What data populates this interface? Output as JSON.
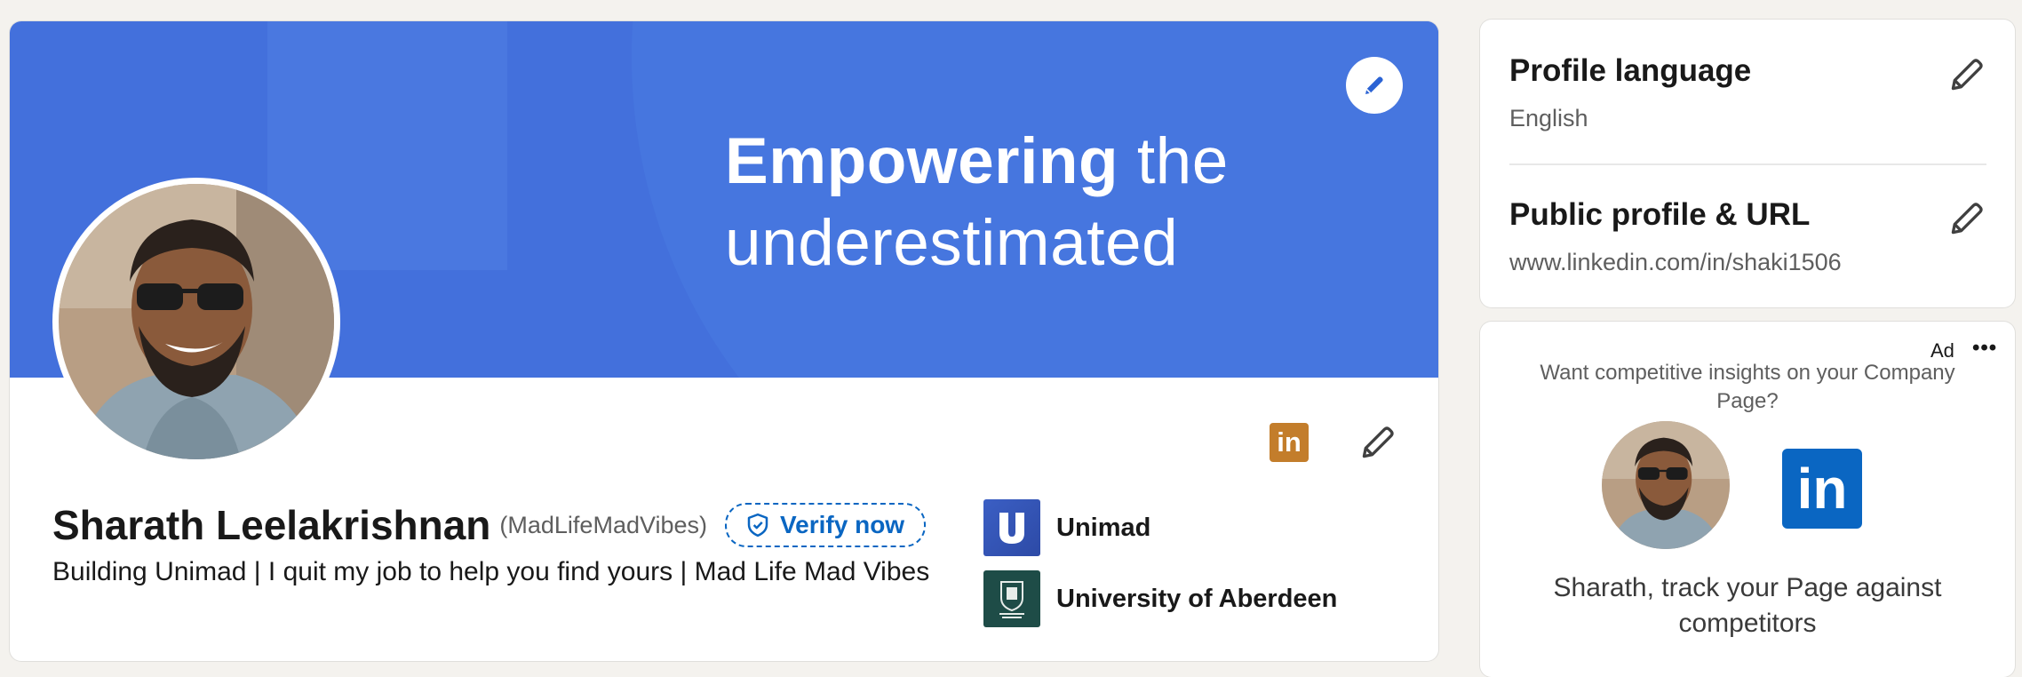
{
  "banner": {
    "title_bold": "Empowering",
    "title_rest": "the",
    "title_line2": "underestimated"
  },
  "profile": {
    "name": "Sharath Leelakrishnan",
    "pronoun": "(MadLifeMadVibes)",
    "verify_label": "Verify now",
    "headline": "Building Unimad | I quit my job to help you find yours | Mad Life Mad Vibes",
    "li_badge": "in"
  },
  "experience": [
    {
      "name": "Unimad",
      "logo_letter": "U",
      "logo_color": "#3b5fc4"
    },
    {
      "name": "University of Aberdeen",
      "logo_color": "#1e4c47"
    }
  ],
  "sidebar": {
    "language_title": "Profile language",
    "language_value": "English",
    "public_title": "Public profile & URL",
    "public_url": "www.linkedin.com/in/shaki1506"
  },
  "ad": {
    "label": "Ad",
    "more": "•••",
    "question": "Want competitive insights on your Company Page?",
    "logo_text": "in",
    "pitch": "Sharath, track your Page against competitors"
  },
  "colors": {
    "banner": "#4370dc",
    "accent": "#0a66c2",
    "li_badge": "#c37d2b"
  },
  "icons": [
    "pencil-icon",
    "shield-check-icon",
    "linkedin-icon",
    "more-icon"
  ]
}
